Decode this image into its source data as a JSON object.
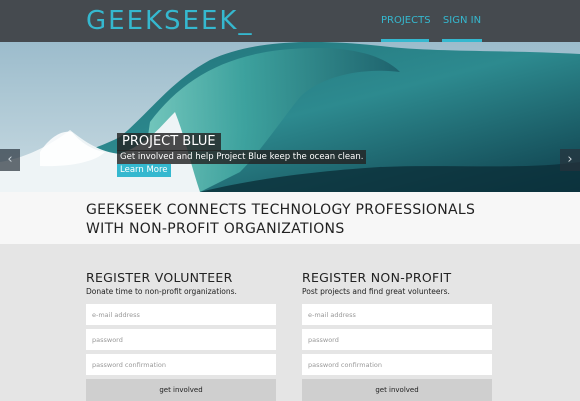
{
  "header": {
    "logo": "GEEKSEEK_",
    "nav": [
      {
        "label": "PROJECTS",
        "active": true
      },
      {
        "label": "SIGN IN",
        "active": true
      }
    ],
    "accent_color": "#35b8cf",
    "background_color": "#454a4f"
  },
  "hero": {
    "caption_title": "PROJECT BLUE",
    "caption_text": "Get involved and help Project Blue keep the ocean clean.",
    "caption_link": "Learn More",
    "prev_icon": "chevron-left-icon",
    "next_icon": "chevron-right-icon",
    "prev_glyph": "‹",
    "next_glyph": "›"
  },
  "tagline": "GEEKSEEK CONNECTS TECHNOLOGY PROFESSIONALS WITH NON-PROFIT ORGANIZATIONS",
  "forms": {
    "volunteer": {
      "heading": "REGISTER VOLUNTEER",
      "subheading": "Donate time to non-profit organizations.",
      "email_placeholder": "e-mail address",
      "password_placeholder": "password",
      "confirm_placeholder": "password confirmation",
      "submit_label": "get involved"
    },
    "nonprofit": {
      "heading": "REGISTER NON-PROFIT",
      "subheading": "Post projects and find great volunteers.",
      "email_placeholder": "e-mail address",
      "password_placeholder": "password",
      "confirm_placeholder": "password confirmation",
      "submit_label": "get involved"
    }
  }
}
